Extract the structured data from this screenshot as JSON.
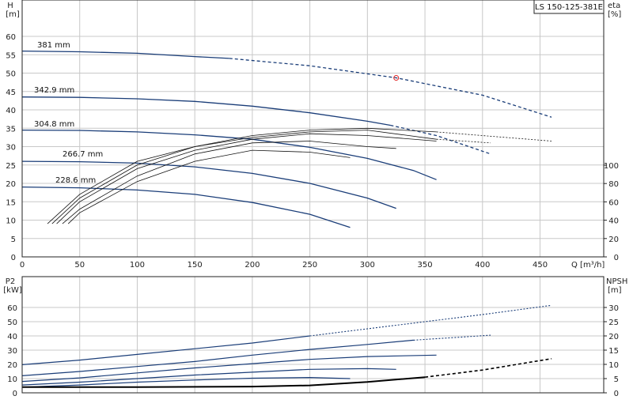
{
  "chart_data": [
    {
      "type": "line",
      "title": "LS 150-125-381E",
      "xlabel": "Q [m³/h]",
      "ylabel_top": "H",
      "ylabel_unit": "[m]",
      "y2label_top": "eta",
      "y2label_unit": "[%]",
      "xlim": [
        0,
        480
      ],
      "ylim": [
        0,
        60
      ],
      "y2lim": [
        0,
        100
      ],
      "xticks": [
        0,
        50,
        100,
        150,
        200,
        250,
        300,
        350,
        400,
        450
      ],
      "yticks": [
        0,
        5,
        10,
        15,
        20,
        25,
        30,
        35,
        40,
        45,
        50,
        55,
        60
      ],
      "y2ticks": [
        0,
        20,
        40,
        60,
        80,
        100
      ],
      "grid": true,
      "series": [
        {
          "name": "381 mm",
          "x": [
            0,
            50,
            100,
            150,
            180
          ],
          "y": [
            56,
            55.8,
            55.4,
            54.5,
            54
          ],
          "dashed_x": [
            180,
            250,
            325,
            400,
            460
          ],
          "dashed_y": [
            54,
            52,
            48.7,
            44,
            38
          ]
        },
        {
          "name": "342.9 mm",
          "x": [
            0,
            50,
            100,
            150,
            200,
            250,
            300,
            320
          ],
          "y": [
            43.5,
            43.4,
            43,
            42.3,
            41,
            39.2,
            36.9,
            35.8
          ],
          "dashed_x": [
            320,
            360,
            407
          ],
          "dashed_y": [
            35.8,
            33,
            28
          ]
        },
        {
          "name": "304.8 mm",
          "x": [
            0,
            50,
            100,
            150,
            200,
            250,
            300,
            340,
            360
          ],
          "y": [
            34.5,
            34.4,
            34,
            33.2,
            32,
            29.8,
            26.8,
            23.5,
            21
          ],
          "dashed_x": [],
          "dashed_y": []
        },
        {
          "name": "266.7 mm",
          "x": [
            0,
            50,
            100,
            150,
            200,
            250,
            300,
            325
          ],
          "y": [
            26,
            25.9,
            25.5,
            24.5,
            22.7,
            20,
            16,
            13.2
          ],
          "dashed_x": [],
          "dashed_y": []
        },
        {
          "name": "228.6 mm",
          "x": [
            0,
            50,
            100,
            150,
            200,
            250,
            285
          ],
          "y": [
            19,
            18.8,
            18.2,
            17,
            14.8,
            11.6,
            8
          ],
          "dashed_x": [],
          "dashed_y": []
        }
      ],
      "operating_point": {
        "x": 325,
        "y": 48.7
      },
      "eta_curves": [
        {
          "x": [
            22,
            50,
            100,
            150,
            200,
            250,
            300,
            360
          ],
          "y": [
            9,
            17,
            26,
            30,
            33,
            34.5,
            35,
            34
          ],
          "dashed_x": [
            360,
            460
          ],
          "dashed_y": [
            34,
            31.5
          ]
        },
        {
          "x": [
            26,
            50,
            100,
            150,
            200,
            250,
            300,
            360
          ],
          "y": [
            9,
            16,
            25,
            30,
            32.5,
            34,
            34.5,
            32
          ],
          "dashed_x": [
            360,
            407
          ],
          "dashed_y": [
            32,
            31
          ]
        },
        {
          "x": [
            30,
            50,
            100,
            150,
            200,
            250,
            300,
            360
          ],
          "y": [
            9,
            15,
            24,
            29,
            32,
            33.5,
            33,
            31.5
          ],
          "dashed_x": [],
          "dashed_y": []
        },
        {
          "x": [
            35,
            50,
            100,
            150,
            200,
            250,
            300,
            325
          ],
          "y": [
            9,
            13,
            22,
            28,
            31,
            31.5,
            30,
            29.5
          ],
          "dashed_x": [],
          "dashed_y": []
        },
        {
          "x": [
            40,
            50,
            100,
            150,
            200,
            250,
            285
          ],
          "y": [
            9,
            12,
            20.5,
            26,
            29,
            28.5,
            27
          ],
          "dashed_x": [],
          "dashed_y": []
        }
      ]
    },
    {
      "type": "line",
      "ylabel_top": "P2",
      "ylabel_unit": "[kW]",
      "y2label_top": "NPSH",
      "y2label_unit": "[m]",
      "xlim": [
        0,
        480
      ],
      "ylim": [
        0,
        70
      ],
      "y2lim": [
        0,
        35
      ],
      "yticks": [
        0,
        10,
        20,
        30,
        40,
        50,
        60
      ],
      "y2ticks": [
        0,
        5,
        10,
        15,
        20,
        25,
        30
      ],
      "grid": true,
      "series": [
        {
          "name": "",
          "x": [
            0,
            50,
            100,
            150,
            200,
            250
          ],
          "y": [
            19.8,
            23,
            27,
            31,
            35,
            40
          ],
          "dashed_x": [
            250,
            300,
            350,
            400,
            460
          ],
          "dashed_y": [
            40,
            45,
            50,
            55,
            61.5
          ]
        },
        {
          "name": "",
          "x": [
            0,
            50,
            100,
            150,
            200,
            250,
            300,
            340
          ],
          "y": [
            12,
            15,
            18.5,
            22,
            26.5,
            30.5,
            34,
            37
          ],
          "dashed_x": [
            340,
            407
          ],
          "dashed_y": [
            37,
            40.5
          ]
        },
        {
          "name": "",
          "x": [
            0,
            50,
            100,
            150,
            200,
            250,
            300,
            360
          ],
          "y": [
            8,
            10.5,
            14,
            17.5,
            20.5,
            23.5,
            25.5,
            26.5
          ],
          "dashed_x": [],
          "dashed_y": []
        },
        {
          "name": "",
          "x": [
            0,
            50,
            100,
            150,
            200,
            250,
            300,
            325
          ],
          "y": [
            5.5,
            7.5,
            10,
            12.5,
            14.5,
            16.5,
            17,
            16.5
          ],
          "dashed_x": [],
          "dashed_y": []
        },
        {
          "name": "",
          "x": [
            0,
            50,
            100,
            150,
            200,
            250,
            285
          ],
          "y": [
            4,
            5.5,
            7.5,
            9,
            10.3,
            10.8,
            10
          ],
          "dashed_x": [],
          "dashed_y": []
        }
      ],
      "npsh_curve": {
        "x": [
          0,
          100,
          200,
          250,
          300,
          350
        ],
        "y": [
          2,
          2,
          2.2,
          2.6,
          3.8,
          5.5
        ],
        "dashed_x": [
          350,
          400,
          460
        ],
        "dashed_y": [
          5.5,
          8,
          12
        ]
      }
    }
  ]
}
